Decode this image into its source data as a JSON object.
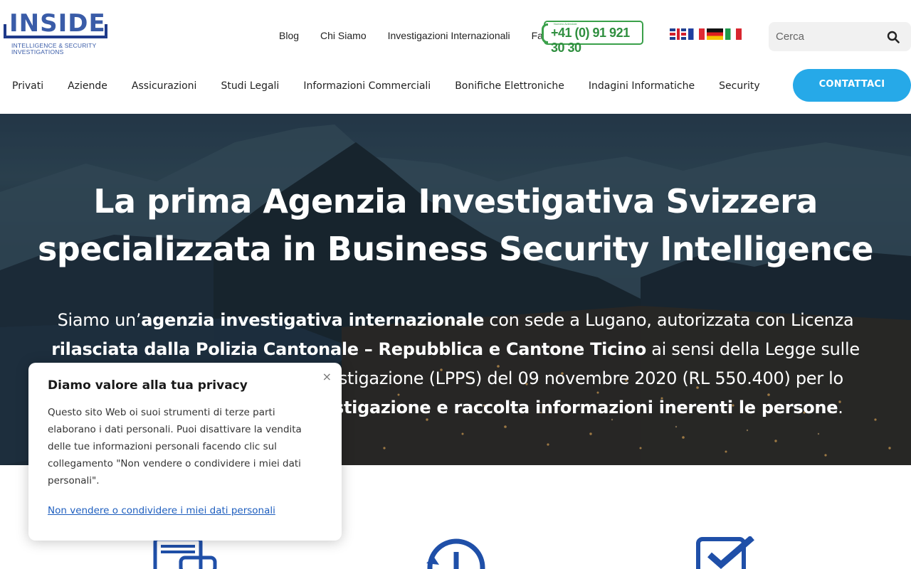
{
  "logo": {
    "word": "INSIDE",
    "subtitle_line1": "INTELLIGENCE & SECURITY",
    "subtitle_line2": "INVESTIGATIONS"
  },
  "topnav": {
    "items": [
      "Blog",
      "Chi Siamo",
      "Investigazioni Internazionali",
      "Faq"
    ]
  },
  "phone": {
    "caption": "Numero Aziendale",
    "number": "+41 (0) 91 921 30 30"
  },
  "flags": [
    "uk-flag-icon",
    "fr-flag-icon",
    "de-flag-icon",
    "it-flag-icon"
  ],
  "search": {
    "placeholder": "Cerca",
    "icon": "search-icon"
  },
  "mainnav": {
    "items": [
      "Privati",
      "Aziende",
      "Assicurazioni",
      "Studi Legali",
      "Informazioni Commerciali",
      "Bonifiche Elettroniche",
      "Indagini Informatiche",
      "Security"
    ]
  },
  "cta": {
    "label": "CONTATTACI",
    "color": "#26a9e8"
  },
  "hero": {
    "title_line1": "La prima Agenzia Investigativa Svizzera",
    "title_line2": "specializzata in Business Security Intelligence",
    "text_1": "Siamo un’",
    "text_2": "agenzia investigativa internazionale",
    "text_3": " con sede a Lugano, autorizzata con Licenza ",
    "text_4": "rilasciata dalla Polizia Cantonale – Repubblica e Cantone Ticino",
    "text_5": " ai sensi della Legge sulle prestazioni di sicurezza e di investigazione (LPPS) del 09 novembre 2020 (RL 550.400) per lo svolgimento di ",
    "text_6": "attività di investigazione e raccolta informazioni inerenti le persone",
    "text_7": "."
  },
  "privacy": {
    "title": "Diamo valore alla tua privacy",
    "body": "Questo sito Web oi suoi strumenti di terze parti elaborano i dati personali. Puoi disattivare la vendita delle tue informazioni personali facendo clic sul collegamento \"Non vendere o condividere i miei dati personali\".",
    "link": "Non vendere o condividere i miei dati personali",
    "close": "×"
  },
  "feature_icons": [
    "document-icon",
    "history-clock-icon",
    "checkbox-icon"
  ],
  "colors": {
    "brand_blue": "#3a5ca8",
    "phone_green": "#3aa04a",
    "link_blue": "#1f5fbf"
  }
}
